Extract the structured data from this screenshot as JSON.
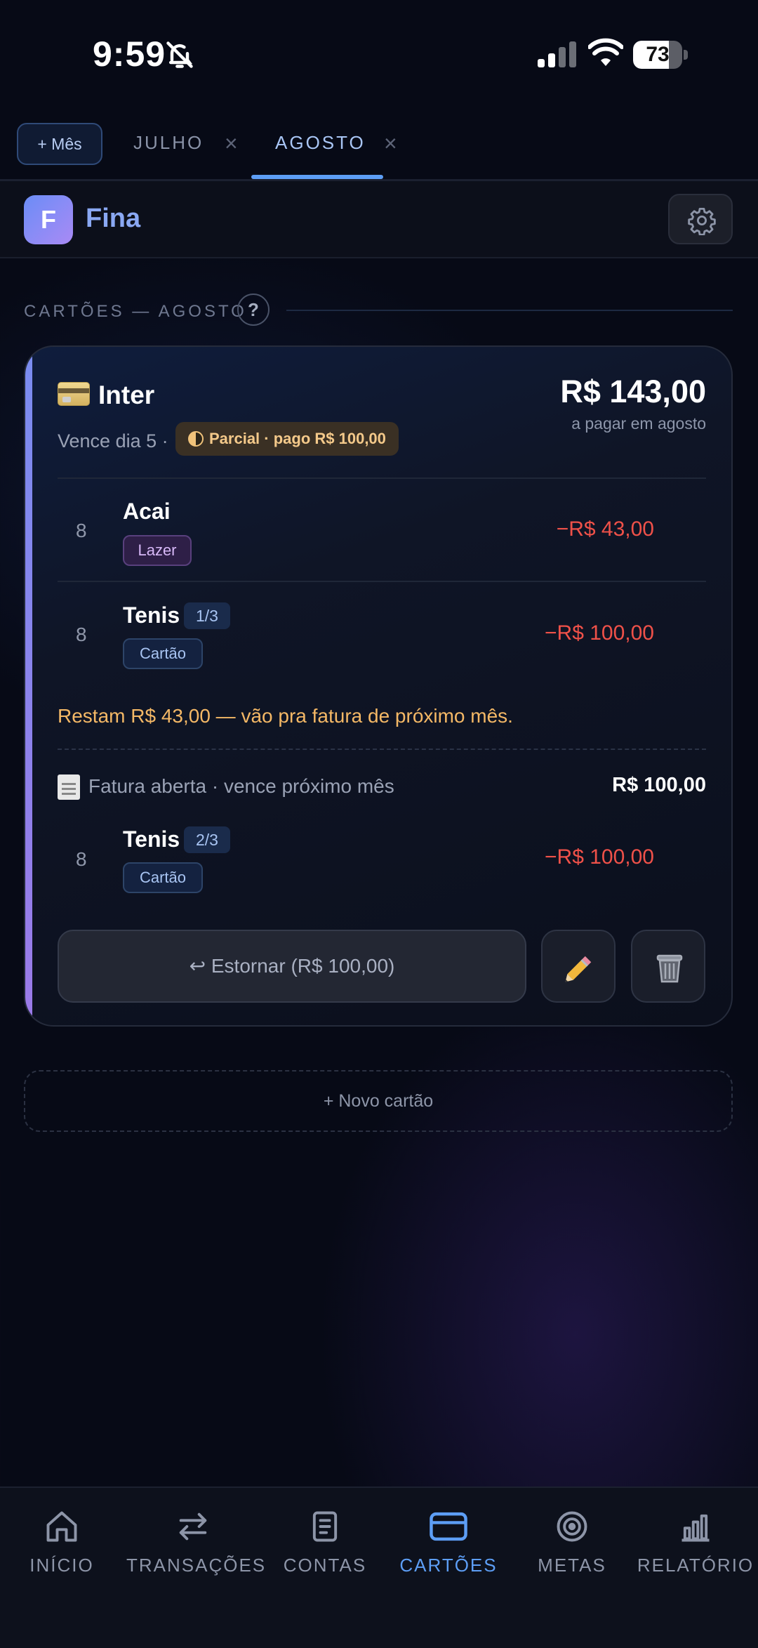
{
  "status_bar": {
    "time": "9:59",
    "battery": "73",
    "battery_level": 0.73
  },
  "month_tabs": {
    "add_label": "+ Mês",
    "tabs": [
      {
        "label": "JULHO",
        "active": false
      },
      {
        "label": "AGOSTO",
        "active": true
      }
    ],
    "close_glyph": "×"
  },
  "header": {
    "logo_letter": "F",
    "brand": "Fina"
  },
  "section": {
    "title": "CARTÕES — AGOSTO",
    "help_glyph": "?"
  },
  "card": {
    "name": "Inter",
    "total": "R$ 143,00",
    "total_sub": "a pagar em agosto",
    "due": "Vence dia 5 ·",
    "status_badge": "Parcial · pago R$ 100,00",
    "transactions": [
      {
        "day": "8",
        "title": "Acai",
        "category": "Lazer",
        "amount": "−R$ 43,00"
      },
      {
        "day": "8",
        "title": "Tenis",
        "installment": "1/3",
        "category": "Cartão",
        "amount": "−R$ 100,00"
      }
    ],
    "remaining_note": "Restam R$ 43,00 — vão pra fatura de próximo mês.",
    "open_invoice": {
      "label": "Fatura aberta · vence próximo mês",
      "amount": "R$ 100,00",
      "transactions": [
        {
          "day": "8",
          "title": "Tenis",
          "installment": "2/3",
          "category": "Cartão",
          "amount": "−R$ 100,00"
        }
      ]
    },
    "actions": {
      "refund_label": "↩ Estornar (R$ 100,00)"
    }
  },
  "new_card_label": "+ Novo cartão",
  "bottom_nav": [
    {
      "label": "INÍCIO",
      "icon": "home-icon",
      "active": false
    },
    {
      "label": "TRANSAÇÕES",
      "icon": "arrows-icon",
      "active": false
    },
    {
      "label": "CONTAS",
      "icon": "document-icon",
      "active": false
    },
    {
      "label": "CARTÕES",
      "icon": "card-icon",
      "active": true
    },
    {
      "label": "METAS",
      "icon": "target-icon",
      "active": false
    },
    {
      "label": "RELATÓRIO",
      "icon": "chart-icon",
      "active": false
    }
  ],
  "colors": {
    "accent": "#5d9ef5",
    "negative": "#ef5149",
    "warning": "#f4b866",
    "background": "#070a16"
  }
}
